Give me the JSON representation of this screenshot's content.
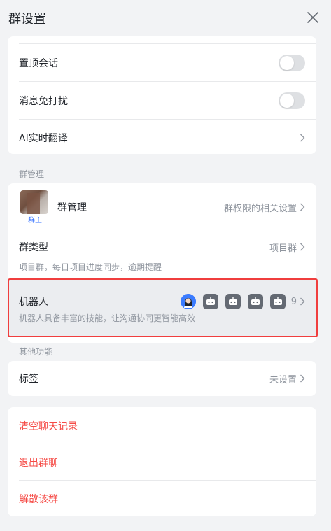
{
  "header": {
    "title": "群设置",
    "close_icon": "close-icon"
  },
  "settings_card": {
    "pin_label": "置顶会话",
    "pin_enabled": false,
    "mute_label": "消息免打扰",
    "mute_enabled": false,
    "translate_label": "AI实时翻译"
  },
  "group_management": {
    "section_title": "群管理",
    "owner_badge": "群主",
    "manage_label": "群管理",
    "manage_right": "群权限的相关设置",
    "type_label": "群类型",
    "type_value": "项目群",
    "type_desc": "项目群，每日项目进度同步，逾期提醒",
    "robot_label": "机器人",
    "robot_desc": "机器人具备丰富的技能，让沟通协同更智能高效",
    "robot_count": "9"
  },
  "other_functions": {
    "section_title": "其他功能",
    "tag_label": "标签",
    "tag_value": "未设置"
  },
  "danger_actions": {
    "clear_history": "清空聊天记录",
    "leave_group": "退出群聊",
    "dissolve_group": "解散该群"
  },
  "colors": {
    "danger": "#f54a45",
    "highlight_border": "#f03e3e",
    "link_blue": "#3370ff"
  }
}
